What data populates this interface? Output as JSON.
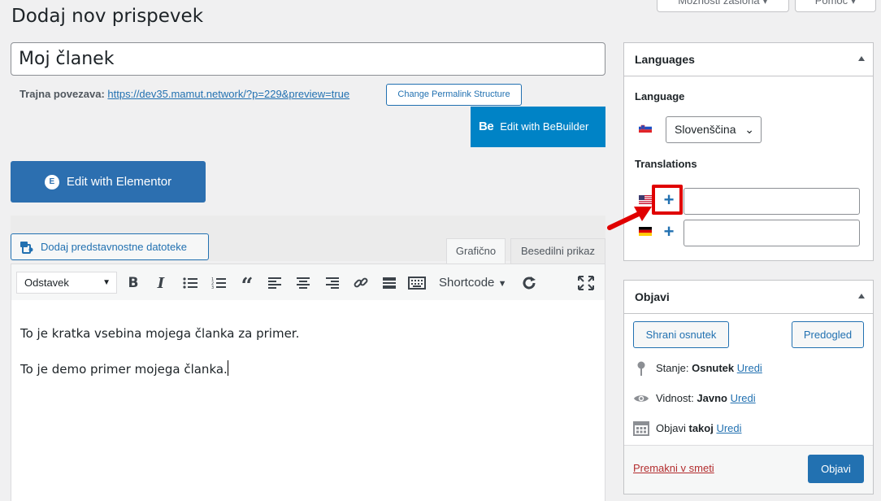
{
  "header": {
    "screen_options_label": "Možnosti zaslona",
    "help_label": "Pomoč",
    "page_title": "Dodaj nov prispevek"
  },
  "post": {
    "title_value": "Moj članek",
    "permalink_label": "Trajna povezava:",
    "permalink_url": "https://dev35.mamut.network/?p=229&preview=true",
    "change_permalink_label": "Change Permalink Structure"
  },
  "builders": {
    "bebuilder_icon_text": "Be",
    "bebuilder_label": "Edit with BeBuilder",
    "elementor_icon_text": "E",
    "elementor_label": "Edit with Elementor"
  },
  "editor": {
    "add_media_label": "Dodaj predstavnostne datoteke",
    "tabs": [
      {
        "label": "Grafično",
        "active": true
      },
      {
        "label": "Besedilni prikaz",
        "active": false
      }
    ],
    "format_select": "Odstavek",
    "shortcode_label": "Shortcode",
    "paragraphs": [
      "To je kratka vsebina mojega članka za primer.",
      "To je demo primer mojega članka."
    ]
  },
  "languages_box": {
    "title": "Languages",
    "language_label": "Language",
    "selected_language": "Slovenščina",
    "translations_label": "Translations",
    "translations": [
      {
        "flag": "us-flag",
        "add_icon": "plus-icon",
        "value": ""
      },
      {
        "flag": "de-flag",
        "add_icon": "plus-icon",
        "value": ""
      }
    ],
    "highlight_color": "#e00000"
  },
  "publish_box": {
    "title": "Objavi",
    "save_draft_label": "Shrani osnutek",
    "preview_label": "Predogled",
    "status_label": "Stanje:",
    "status_value": "Osnutek",
    "visibility_label": "Vidnost:",
    "visibility_value": "Javno",
    "publish_time_label": "Objavi",
    "publish_time_value": "takoj",
    "edit_link": "Uredi",
    "trash_label": "Premakni v smeti",
    "publish_label": "Objavi"
  },
  "colors": {
    "accent": "#2271b1",
    "bebuilder": "#0083c6",
    "elementor": "#2c6fb0",
    "arrow": "#e00000"
  }
}
